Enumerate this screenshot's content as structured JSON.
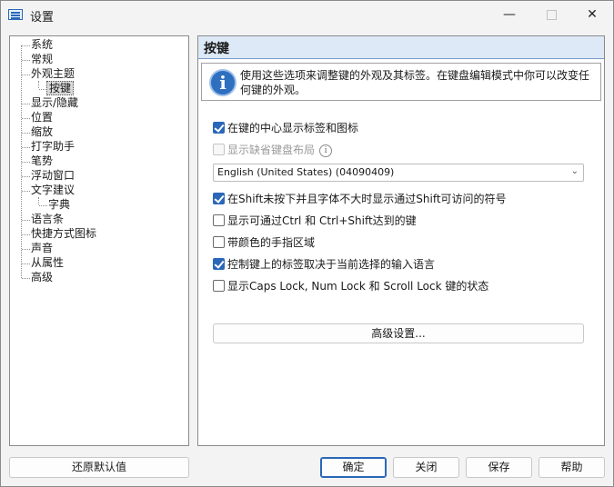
{
  "window": {
    "title": "设置",
    "minimize_glyph": "—",
    "close_glyph": "✕"
  },
  "tree": {
    "items": [
      {
        "label": "系统"
      },
      {
        "label": "常规"
      },
      {
        "label": "外观主题"
      },
      {
        "label": "按键",
        "selected": true
      },
      {
        "label": "显示/隐藏"
      },
      {
        "label": "位置"
      },
      {
        "label": "缩放"
      },
      {
        "label": "打字助手"
      },
      {
        "label": "笔势"
      },
      {
        "label": "浮动窗口"
      },
      {
        "label": "文字建议"
      },
      {
        "label": "字典"
      },
      {
        "label": "语言条"
      },
      {
        "label": "快捷方式图标"
      },
      {
        "label": "声音"
      },
      {
        "label": "从属性"
      },
      {
        "label": "高级"
      }
    ]
  },
  "panel": {
    "title": "按键",
    "info_icon": "i",
    "info_text": "使用这些选项来调整键的外观及其标签。在键盘编辑模式中你可以改变任何键的外观。",
    "options": [
      {
        "label": "在键的中心显示标签和图标",
        "checked": true,
        "disabled": false
      },
      {
        "label": "显示缺省键盘布局",
        "checked": false,
        "disabled": true
      },
      {
        "label": "在Shift未按下并且字体不大时显示通过Shift可访问的符号",
        "checked": true,
        "disabled": false
      },
      {
        "label": "显示可通过Ctrl 和 Ctrl+Shift达到的键",
        "checked": false,
        "disabled": false
      },
      {
        "label": "带颜色的手指区域",
        "checked": false,
        "disabled": false
      },
      {
        "label": "控制键上的标签取决于当前选择的输入语言",
        "checked": true,
        "disabled": false
      },
      {
        "label": "显示Caps Lock, Num Lock 和 Scroll Lock 键的状态",
        "checked": false,
        "disabled": false
      }
    ],
    "layout_select": "English (United States) (04090409)",
    "advanced_button": "高级设置..."
  },
  "footer": {
    "restore_defaults": "还原默认值",
    "ok": "确定",
    "close": "关闭",
    "save": "保存",
    "help": "帮助"
  },
  "colors": {
    "accent": "#2a67b8",
    "header_bg": "#dde9f7"
  }
}
